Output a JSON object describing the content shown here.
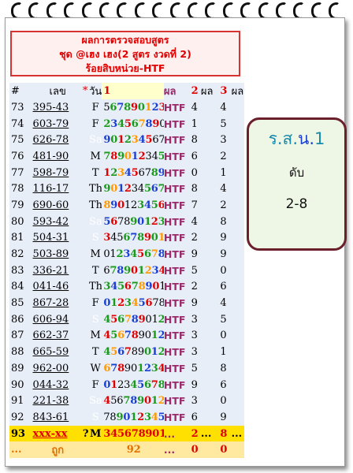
{
  "header": {
    "line1": "ผลการตรวจสอบสูตร",
    "line2": "ชุด @เฮง เฮง(2 สูตร งวดที่ 2)",
    "line3": "ร้อยสิบหน่วย-HTF"
  },
  "columns": {
    "idx": "#",
    "number": "เลข",
    "star": "*",
    "day": "วัน",
    "digits": "1",
    "result": "ผล",
    "r1": "2",
    "r1_label": "ผล",
    "r2": "3",
    "r2_label": "ผล"
  },
  "rows": [
    {
      "idx": "73",
      "number": "395-43",
      "day": "F",
      "digits": "567890123",
      "r1": "4",
      "r2": "4"
    },
    {
      "idx": "74",
      "number": "603-79",
      "day": "F",
      "digits": "234567890",
      "r1": "1",
      "r2": "5"
    },
    {
      "idx": "75",
      "number": "626-78",
      "day": "Sa",
      "digits": "901234567",
      "r1": "8",
      "r2": "3"
    },
    {
      "idx": "76",
      "number": "481-90",
      "day": "M",
      "digits": "789012345",
      "r1": "6",
      "r2": "2"
    },
    {
      "idx": "77",
      "number": "598-79",
      "day": "T",
      "digits": "123456789",
      "r1": "0",
      "r2": "1"
    },
    {
      "idx": "78",
      "number": "116-17",
      "day": "Th",
      "digits": "901234567",
      "r1": "8",
      "r2": "4"
    },
    {
      "idx": "79",
      "number": "690-60",
      "day": "Th",
      "digits": "890123456",
      "r1": "7",
      "r2": "2"
    },
    {
      "idx": "80",
      "number": "593-42",
      "day": "Sa",
      "digits": "567890123",
      "r1": "4",
      "r2": "8"
    },
    {
      "idx": "81",
      "number": "504-31",
      "day": "S",
      "digits": "345678901",
      "r1": "2",
      "r2": "9"
    },
    {
      "idx": "82",
      "number": "503-89",
      "day": "M",
      "digits": "012345678",
      "r1": "9",
      "r2": "9"
    },
    {
      "idx": "83",
      "number": "336-21",
      "day": "T",
      "digits": "678901234",
      "r1": "5",
      "r2": "0"
    },
    {
      "idx": "84",
      "number": "041-46",
      "day": "Th",
      "digits": "345678901",
      "r1": "2",
      "r2": "6"
    },
    {
      "idx": "85",
      "number": "867-28",
      "day": "F",
      "digits": "012345678",
      "r1": "9",
      "r2": "4"
    },
    {
      "idx": "86",
      "number": "606-94",
      "day": "S",
      "digits": "456789012",
      "r1": "3",
      "r2": "5"
    },
    {
      "idx": "87",
      "number": "662-37",
      "day": "M",
      "digits": "456789012",
      "r1": "3",
      "r2": "0"
    },
    {
      "idx": "88",
      "number": "665-59",
      "day": "T",
      "digits": "456789012",
      "r1": "3",
      "r2": "1"
    },
    {
      "idx": "89",
      "number": "962-00",
      "day": "W",
      "digits": "678901234",
      "r1": "5",
      "r2": "8"
    },
    {
      "idx": "90",
      "number": "044-32",
      "day": "F",
      "digits": "012345678",
      "r1": "9",
      "r2": "6"
    },
    {
      "idx": "91",
      "number": "221-38",
      "day": "Sa",
      "digits": "456789012",
      "r1": "3",
      "r2": "0"
    },
    {
      "idx": "92",
      "number": "843-61",
      "day": "S",
      "digits": "789012345",
      "r1": "6",
      "r2": "9"
    }
  ],
  "result_label": "HTF",
  "current_row": {
    "idx": "93",
    "number": "xxx-xx",
    "star": "?",
    "day": "M",
    "digits": "345678901",
    "result": "...",
    "r1": "2",
    "r1_label": "...",
    "r2": "8",
    "r2_label": "..."
  },
  "total_row": {
    "idx": "...",
    "label": "ถูก",
    "digits": "92",
    "result": "...",
    "r1": "0",
    "r2": "0"
  },
  "card": {
    "title_a": "ร.ส.",
    "title_b": "น.",
    "title_c": "1",
    "subtitle": "ดับ",
    "value": "2-8"
  },
  "colors": {
    "day_F": "#66ddee",
    "day_Sa": "#6688cc",
    "day_M": "#ffffff",
    "day_T": "#ff88dd",
    "day_Th": "#ffaa66",
    "day_S": "#ee3344",
    "day_W": "#55ee55",
    "htf": "#9b2a6a",
    "header_red": "#e00000"
  }
}
